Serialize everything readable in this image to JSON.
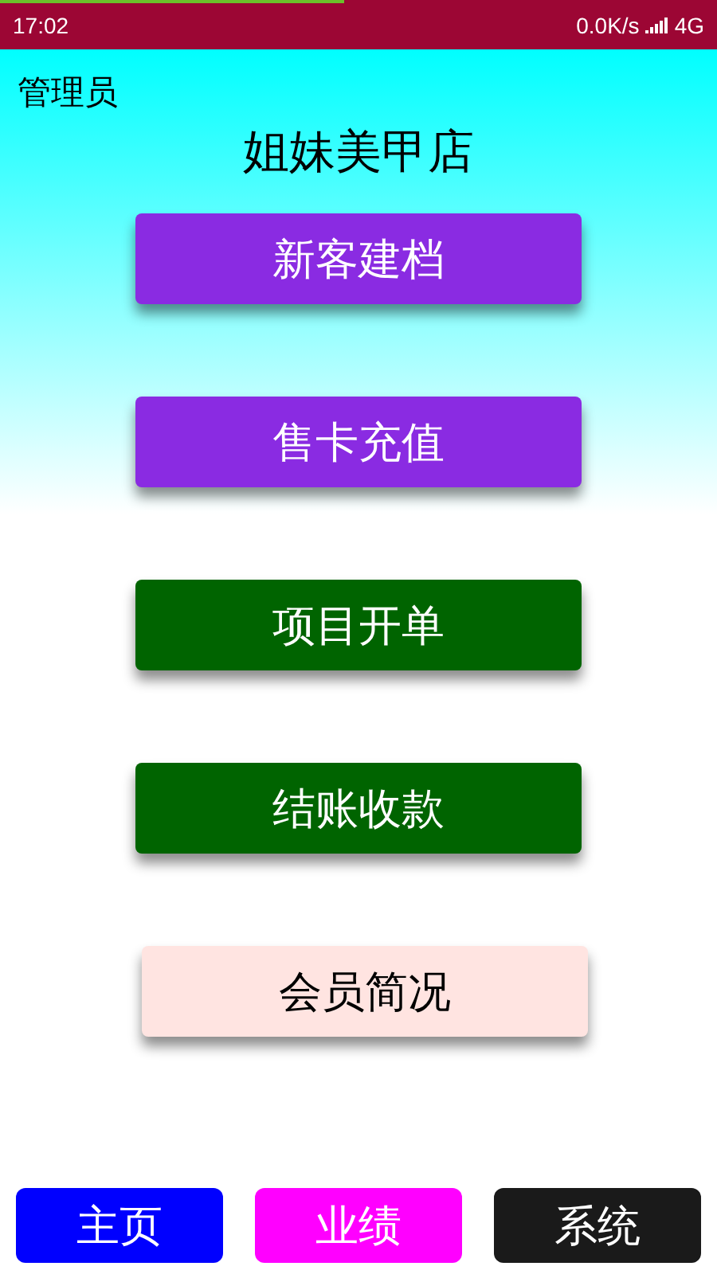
{
  "status_bar": {
    "time": "17:02",
    "speed": "0.0K/s",
    "network": "4G",
    "load_progress": {
      "level": 0.48
    }
  },
  "user_role": "管理员",
  "title": "姐妹美甲店",
  "menu": [
    {
      "label": "新客建档",
      "color": "#8a2be2"
    },
    {
      "label": "售卡充值",
      "color": "#8a2be2"
    },
    {
      "label": "项目开单",
      "color": "#006400"
    },
    {
      "label": "结账收款",
      "color": "#006400"
    },
    {
      "label": "会员简况",
      "color": "#ffe4e1"
    }
  ],
  "nav": [
    {
      "label": "主页",
      "color": "#0000ff"
    },
    {
      "label": "业绩",
      "color": "#ff00ff"
    },
    {
      "label": "系统",
      "color": "#1a1a1a"
    }
  ]
}
